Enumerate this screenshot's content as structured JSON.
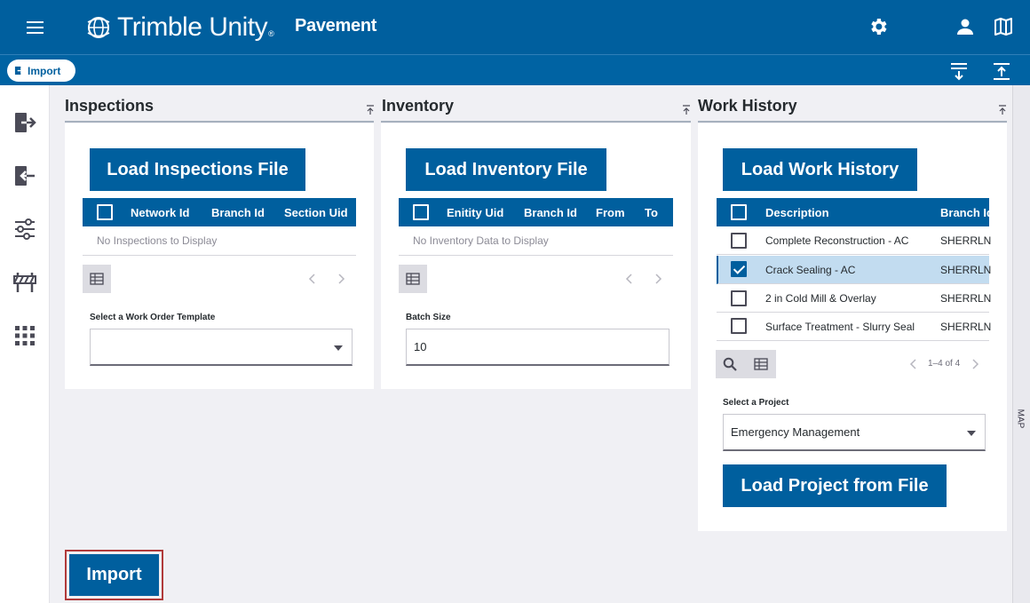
{
  "header": {
    "brand_name": "Trimble",
    "brand_suffix": "Unity",
    "brand_mark": "®",
    "app_name": "Pavement",
    "icons": [
      "menu-icon",
      "gear-icon",
      "user-icon",
      "map-icon"
    ]
  },
  "subbar": {
    "import_label": "Import",
    "icons": [
      "collapse-all-icon",
      "expand-all-icon"
    ]
  },
  "rail": {
    "icons": [
      "import-icon",
      "export-icon",
      "sliders-icon",
      "barrier-icon",
      "apps-grid-icon"
    ]
  },
  "map_tab": "MAP",
  "inspections": {
    "title": "Inspections",
    "load_button": "Load Inspections File",
    "columns": [
      "Network Id",
      "Branch Id",
      "Section Uid"
    ],
    "empty_text": "No Inspections to Display",
    "template_label": "Select a Work Order Template",
    "template_value": ""
  },
  "inventory": {
    "title": "Inventory",
    "load_button": "Load Inventory File",
    "columns": [
      "Enitity Uid",
      "Branch Id",
      "From",
      "To"
    ],
    "empty_text": "No Inventory Data to Display",
    "batch_label": "Batch Size",
    "batch_value": "10"
  },
  "work_history": {
    "title": "Work History",
    "load_button": "Load Work History",
    "columns": [
      "Description",
      "Branch Id"
    ],
    "rows": [
      {
        "description": "Complete Reconstruction - AC",
        "branch": "SHERRLN",
        "checked": false
      },
      {
        "description": "Crack Sealing - AC",
        "branch": "SHERRLN",
        "checked": true
      },
      {
        "description": "2 in Cold Mill & Overlay",
        "branch": "SHERRLN",
        "checked": false
      },
      {
        "description": "Surface Treatment - Slurry Seal",
        "branch": "SHERRLN",
        "checked": false
      }
    ],
    "pager": "1–4 of 4",
    "project_label": "Select a Project",
    "project_value": "Emergency Management",
    "load_project_button": "Load Project from File"
  },
  "import_button": "Import",
  "colors": {
    "primary": "#005f9e",
    "selected_row": "#c2dcf0",
    "focus_outline": "#b03a3a"
  }
}
